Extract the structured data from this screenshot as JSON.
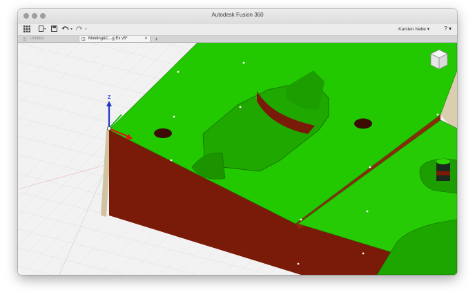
{
  "window": {
    "title": "Autodesk Fusion 360"
  },
  "toolbar": {
    "grid_icon": "grid-menu-icon",
    "save_icon": "save-icon",
    "undo_icon": "undo-icon",
    "redo_icon": "redo-icon",
    "user_name": "Karsten Nebe ▾",
    "help_label": "? ▾"
  },
  "tabs": [
    {
      "label": "Untitled",
      "active": false
    },
    {
      "label": "Molding&C...g Ex v5*",
      "active": true
    }
  ],
  "viewport": {
    "axis_z_label": "Z",
    "colors": {
      "face_green": "#22c800",
      "side_red": "#7a1a08",
      "edge_beige": "#cfc3a0"
    }
  }
}
